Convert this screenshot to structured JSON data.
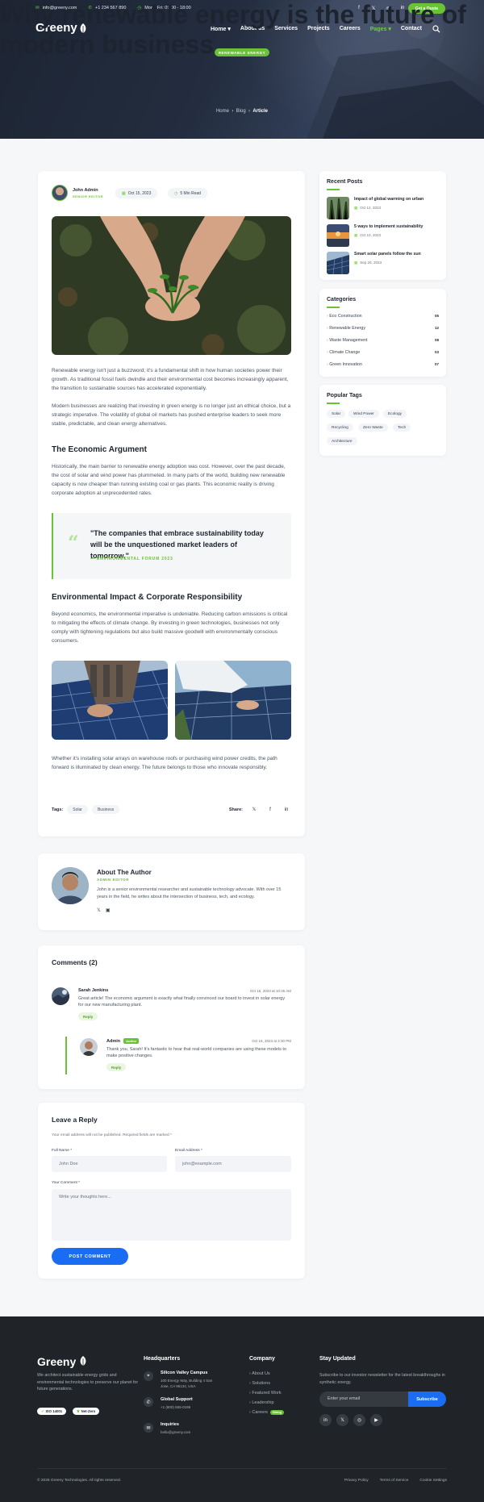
{
  "topbar": {
    "email": "info@greeny.com",
    "phone": "+1 234 567 890",
    "hours": "Mon - Fri: 09:00 - 18:00",
    "quote_btn": "Get a Quote"
  },
  "nav": {
    "logo": "Greeny",
    "items": [
      {
        "label": "Home"
      },
      {
        "label": "About us"
      },
      {
        "label": "Services"
      },
      {
        "label": "Projects"
      },
      {
        "label": "Careers"
      },
      {
        "label": "Pages"
      },
      {
        "label": "Contact"
      }
    ]
  },
  "hero": {
    "badge": "RENEWABLE ENERGY",
    "title": "Why renewable energy is the future of modern business",
    "crumb": {
      "home": "Home",
      "blog": "Blog",
      "current": "Article"
    }
  },
  "article": {
    "author": "John Admin",
    "author_role": "SENIOR EDITOR",
    "date": "Oct 15, 2023",
    "read": "5 Min Read",
    "p1": "Renewable energy isn't just a buzzword; it's a fundamental shift in how human societies power their growth. As traditional fossil fuels dwindle and their environmental cost becomes increasingly apparent, the transition to sustainable sources has accelerated exponentially.",
    "p2": "Modern businesses are realizing that investing in green energy is no longer just an ethical choice, but a strategic imperative. The volatility of global oil markets has pushed enterprise leaders to seek more stable, predictable, and clean energy alternatives.",
    "h_economic": "The Economic Argument",
    "p3": "Historically, the main barrier to renewable energy adoption was cost. However, over the past decade, the cost of solar and wind power has plummeted. In many parts of the world, building new renewable capacity is now cheaper than running existing coal or gas plants. This economic reality is driving corporate adoption at unprecedented rates.",
    "quote": "\"The companies that embrace sustainability today will be the unquestioned market leaders of tomorrow.\"",
    "quote_src": "— ENVIRONMENTAL FORUM 2023",
    "h_env": "Environmental Impact & Corporate Responsibility",
    "p4": "Beyond economics, the environmental imperative is undeniable. Reducing carbon emissions is critical to mitigating the effects of climate change. By investing in green technologies, businesses not only comply with tightening regulations but also build massive goodwill with environmentally conscious consumers.",
    "p5": "Whether it's installing solar arrays on warehouse roofs or purchasing wind power credits, the path forward is illuminated by clean energy. The future belongs to those who innovate responsibly.",
    "tags_label": "Tags:",
    "tags": [
      "Solar",
      "Business"
    ],
    "share_label": "Share:"
  },
  "about": {
    "title": "About The Author",
    "role": "ADMIN EDITOR",
    "bio": "John is a senior environmental researcher and sustainable technology advocate. With over 15 years in the field, he writes about the intersection of business, tech, and ecology."
  },
  "comments": {
    "title": "Comments (2)",
    "items": [
      {
        "name": "Sarah Jenkins",
        "date": "Oct 16, 2023 at 10:45 AM",
        "text": "Great article! The economic argument is exactly what finally convinced our board to invest in solar energy for our new manufacturing plant.",
        "reply": "Reply"
      },
      {
        "name": "Admin",
        "badge": "Author",
        "date": "Oct 16, 2023 at 2:30 PM",
        "text": "Thank you, Sarah! It's fantastic to hear that real-world companies are using these models to make positive changes.",
        "reply": "Reply"
      }
    ]
  },
  "form": {
    "title": "Leave a Reply",
    "note": "Your email address will not be published. Required fields are marked *",
    "name_label": "Full Name *",
    "name_value": "John Doe",
    "email_label": "Email Address *",
    "email_value": "john@example.com",
    "comment_label": "Your Comment *",
    "comment_placeholder": "Write your thoughts here...",
    "submit": "POST COMMENT"
  },
  "sidebar": {
    "recent_title": "Recent Posts",
    "recent": [
      {
        "title": "Impact of global warming on urban",
        "date": "Oct 12, 2023"
      },
      {
        "title": "5 ways to implement sustainability",
        "date": "Oct 10, 2023"
      },
      {
        "title": "Smart solar panels follow the sun",
        "date": "Sep 20, 2023"
      }
    ],
    "cat_title": "Categories",
    "categories": [
      {
        "name": "Eco Construction",
        "count": "05"
      },
      {
        "name": "Renewable Energy",
        "count": "12"
      },
      {
        "name": "Waste Management",
        "count": "08"
      },
      {
        "name": "Climate Change",
        "count": "03"
      },
      {
        "name": "Green Innovation",
        "count": "07"
      }
    ],
    "tags_title": "Popular Tags",
    "tags": [
      "Solar",
      "Wind Power",
      "Ecology",
      "Recycling",
      "Zero Waste",
      "Tech",
      "Architecture"
    ]
  },
  "footer": {
    "logo": "Greeny",
    "desc": "We architect sustainable energy grids and environmental technologies to preserve our planet for future generations.",
    "badge1": "ISO 14001",
    "badge2": "Net-Zero",
    "hq_title": "Headquarters",
    "hq1_title": "Silicon Valley Campus",
    "hq1_text": "100 Energy Way, Building 4 San Jose, CA 95134, USA",
    "hq2_title": "Global Support",
    "hq2_text": "+1 (800) 555-0199",
    "hq3_title": "Inquiries",
    "hq3_text": "hello@greeny.com",
    "company_title": "Company",
    "company": [
      "About Us",
      "Solutions",
      "Featured Work",
      "Leadership",
      "Careers"
    ],
    "hiring": "Hiring",
    "stay_title": "Stay Updated",
    "stay_text": "Subscribe to our investor newsletter for the latest breakthroughs in synthetic energy.",
    "newsletter_placeholder": "Enter your email",
    "subscribe": "Subscribe",
    "copyright": "© 2026 Greeny Technologies. All rights reserved.",
    "links": [
      "Privacy Policy",
      "Terms of Service",
      "Cookie Settings"
    ]
  },
  "colors": {
    "accent": "#6ac235",
    "primary": "#1a6df2",
    "dark": "#202428"
  }
}
